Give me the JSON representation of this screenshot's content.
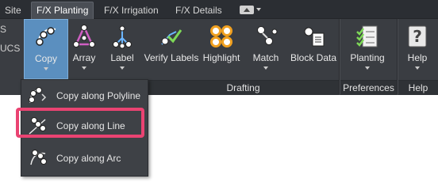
{
  "tabs": [
    {
      "label": "Site"
    },
    {
      "label": "F/X Planting",
      "active": true
    },
    {
      "label": "F/X Irrigation"
    },
    {
      "label": "F/X Details"
    }
  ],
  "left_partial": [
    "S",
    "UCS"
  ],
  "tools": [
    {
      "label": "Copy",
      "icon": "copy-circles-icon"
    },
    {
      "label": "Array",
      "icon": "array-icon"
    },
    {
      "label": "Label",
      "icon": "label-icon"
    },
    {
      "label": "Verify Labels",
      "icon": "verify-labels-icon"
    },
    {
      "label": "Highlight",
      "icon": "highlight-icon"
    },
    {
      "label": "Match",
      "icon": "match-icon"
    },
    {
      "label": "Block Data",
      "icon": "block-data-icon"
    },
    {
      "label": "Planting",
      "icon": "planting-checklist-icon"
    },
    {
      "label": "Help",
      "icon": "help-icon"
    }
  ],
  "panels": [
    "Drafting",
    "Preferences",
    "Help"
  ],
  "dropdown": {
    "items": [
      {
        "label": "Copy along Polyline",
        "icon": "copy-along-polyline-icon"
      },
      {
        "label": "Copy along Line",
        "icon": "copy-along-line-icon",
        "highlighted": true
      },
      {
        "label": "Copy along Arc",
        "icon": "copy-along-arc-icon"
      }
    ]
  },
  "colors": {
    "ribbon": "#3a3d42",
    "copy_button": "#5b8fbf",
    "highlight_border": "#ea4372"
  }
}
